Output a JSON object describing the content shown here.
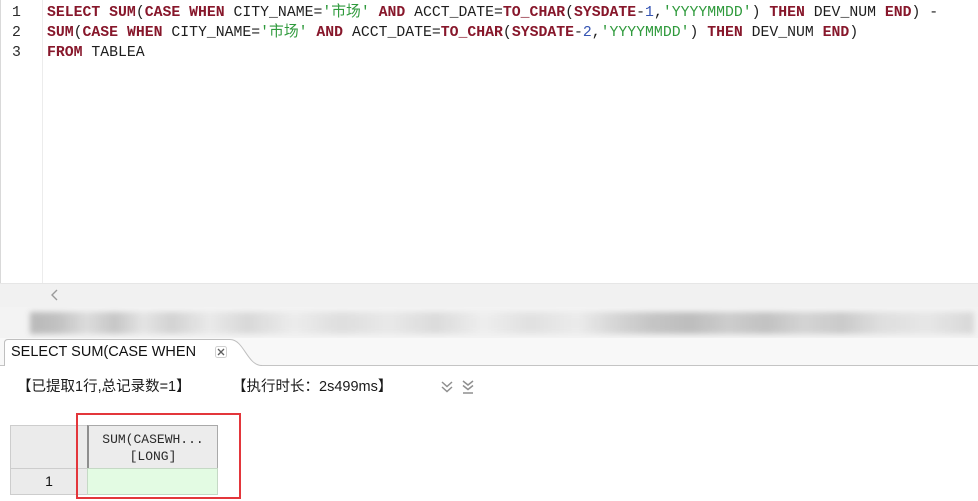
{
  "editor": {
    "lines": [
      {
        "number": "1",
        "tokens": [
          {
            "text": "SELECT",
            "color": "#87172b",
            "bold": true
          },
          {
            "text": " ",
            "color": "#1e1e1e"
          },
          {
            "text": "SUM",
            "color": "#87172b",
            "bold": true
          },
          {
            "text": "(",
            "color": "#1e1e1e"
          },
          {
            "text": "CASE",
            "color": "#87172b",
            "bold": true
          },
          {
            "text": " ",
            "color": "#1e1e1e"
          },
          {
            "text": "WHEN",
            "color": "#87172b",
            "bold": true
          },
          {
            "text": " CITY_NAME=",
            "color": "#1e1e1e"
          },
          {
            "text": "'市场'",
            "color": "#2f9a3c"
          },
          {
            "text": " ",
            "color": "#1e1e1e"
          },
          {
            "text": "AND",
            "color": "#87172b",
            "bold": true
          },
          {
            "text": " ACCT_DATE=",
            "color": "#1e1e1e"
          },
          {
            "text": "TO_CHAR",
            "color": "#87172b",
            "bold": true
          },
          {
            "text": "(",
            "color": "#1e1e1e"
          },
          {
            "text": "SYSDATE",
            "color": "#87172b",
            "bold": true
          },
          {
            "text": "-",
            "color": "#1e1e1e"
          },
          {
            "text": "1",
            "color": "#3655b3"
          },
          {
            "text": ",",
            "color": "#1e1e1e"
          },
          {
            "text": "'YYYYMMDD'",
            "color": "#2f9a3c"
          },
          {
            "text": ") ",
            "color": "#1e1e1e"
          },
          {
            "text": "THEN",
            "color": "#87172b",
            "bold": true
          },
          {
            "text": " DEV_NUM ",
            "color": "#1e1e1e"
          },
          {
            "text": "END",
            "color": "#87172b",
            "bold": true
          },
          {
            "text": ") -",
            "color": "#1e1e1e"
          }
        ]
      },
      {
        "number": "2",
        "tokens": [
          {
            "text": "SUM",
            "color": "#87172b",
            "bold": true
          },
          {
            "text": "(",
            "color": "#1e1e1e"
          },
          {
            "text": "CASE",
            "color": "#87172b",
            "bold": true
          },
          {
            "text": " ",
            "color": "#1e1e1e"
          },
          {
            "text": "WHEN",
            "color": "#87172b",
            "bold": true
          },
          {
            "text": " CITY_NAME=",
            "color": "#1e1e1e"
          },
          {
            "text": "'市场'",
            "color": "#2f9a3c"
          },
          {
            "text": " ",
            "color": "#1e1e1e"
          },
          {
            "text": "AND",
            "color": "#87172b",
            "bold": true
          },
          {
            "text": " ACCT_DATE=",
            "color": "#1e1e1e"
          },
          {
            "text": "TO_CHAR",
            "color": "#87172b",
            "bold": true
          },
          {
            "text": "(",
            "color": "#1e1e1e"
          },
          {
            "text": "SYSDATE",
            "color": "#87172b",
            "bold": true
          },
          {
            "text": "-",
            "color": "#1e1e1e"
          },
          {
            "text": "2",
            "color": "#3655b3"
          },
          {
            "text": ",",
            "color": "#1e1e1e"
          },
          {
            "text": "'YYYYMMDD'",
            "color": "#2f9a3c"
          },
          {
            "text": ") ",
            "color": "#1e1e1e"
          },
          {
            "text": "THEN",
            "color": "#87172b",
            "bold": true
          },
          {
            "text": " DEV_NUM ",
            "color": "#1e1e1e"
          },
          {
            "text": "END",
            "color": "#87172b",
            "bold": true
          },
          {
            "text": ")",
            "color": "#1e1e1e"
          }
        ]
      },
      {
        "number": "3",
        "tokens": [
          {
            "text": "FROM",
            "color": "#87172b",
            "bold": true
          },
          {
            "text": " TABLEA",
            "color": "#1e1e1e"
          }
        ]
      }
    ],
    "scroll_icon": "chevron-left-icon"
  },
  "result_tab": {
    "label": "SELECT SUM(CASE WHEN",
    "close_icon": "close-icon"
  },
  "result_summary": {
    "fetched": "【已提取1行,总记录数=1】",
    "duration": "【执行时长：2s499ms】"
  },
  "result_toolbar": {
    "icons": [
      "double-chevron-down-icon",
      "double-chevron-down-bar-icon"
    ]
  },
  "grid": {
    "columns": [
      {
        "name": "SUM(CASEWH...",
        "type": "[LONG]"
      }
    ],
    "rows": [
      {
        "number": "1",
        "cells": [
          ""
        ]
      }
    ]
  },
  "colors": {
    "result_cell": "#e3fbe3",
    "highlight_box": "#e3363b"
  }
}
